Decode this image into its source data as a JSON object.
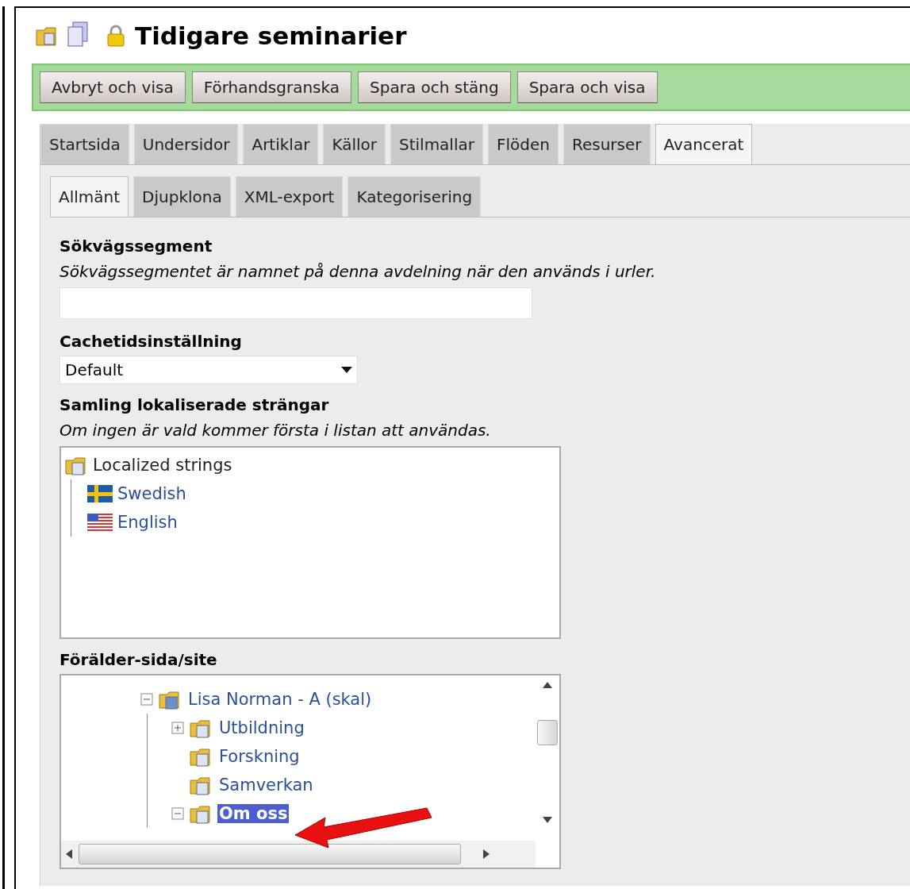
{
  "title": "Tidigare seminarier",
  "toolbar": [
    "Avbryt och visa",
    "Förhandsgranska",
    "Spara och stäng",
    "Spara och visa"
  ],
  "tabs": [
    {
      "label": "Startsida",
      "selected": false
    },
    {
      "label": "Undersidor",
      "selected": false
    },
    {
      "label": "Artiklar",
      "selected": false
    },
    {
      "label": "Källor",
      "selected": false
    },
    {
      "label": "Stilmallar",
      "selected": false
    },
    {
      "label": "Flöden",
      "selected": false
    },
    {
      "label": "Resurser",
      "selected": false
    },
    {
      "label": "Avancerat",
      "selected": true
    }
  ],
  "subtabs": [
    {
      "label": "Allmänt",
      "selected": true
    },
    {
      "label": "Djupklona",
      "selected": false
    },
    {
      "label": "XML-export",
      "selected": false
    },
    {
      "label": "Kategorisering",
      "selected": false
    }
  ],
  "path_segment": {
    "label": "Sökvägssegment",
    "hint": "Sökvägssegmentet är namnet på denna avdelning när den används i urler."
  },
  "cache": {
    "label": "Cachetidsinställning",
    "value": "Default"
  },
  "strings": {
    "label": "Samling lokaliserade strängar",
    "hint": "Om ingen är vald kommer första i listan att användas.",
    "root": "Localized strings",
    "items": [
      {
        "label": "Swedish",
        "kind": "swedish"
      },
      {
        "label": "English",
        "kind": "english"
      }
    ]
  },
  "parent": {
    "label": "Förälder-sida/site",
    "tree": [
      {
        "label": "Lisa Norman - A (skal)",
        "kind": "site",
        "expanded": true,
        "selected": false,
        "children": [
          {
            "label": "Utbildning",
            "kind": "page",
            "expanded": false,
            "selected": false
          },
          {
            "label": "Forskning",
            "kind": "page",
            "selected": false
          },
          {
            "label": "Samverkan",
            "kind": "page",
            "selected": false
          },
          {
            "label": "Om oss",
            "kind": "page",
            "expanded": true,
            "selected": true
          }
        ]
      }
    ]
  }
}
